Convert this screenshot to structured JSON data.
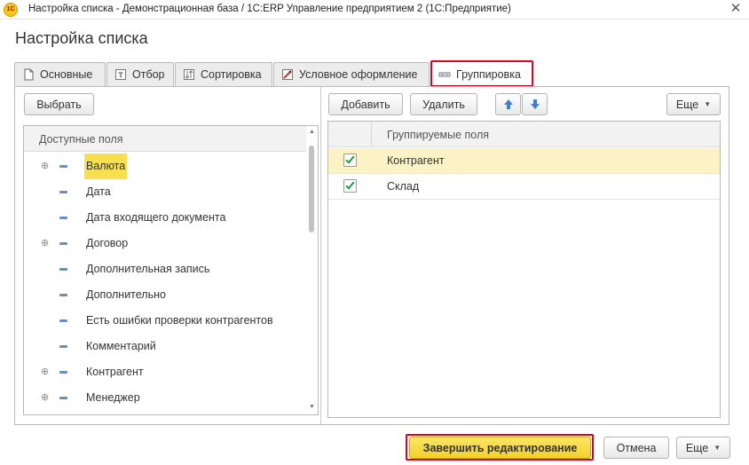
{
  "window": {
    "logo_text": "1С",
    "title": "Настройка списка - Демонстрационная база / 1С:ERP Управление предприятием 2  (1С:Предприятие)",
    "close_glyph": "✕"
  },
  "form": {
    "title": "Настройка списка"
  },
  "tabs": [
    {
      "label": "Основные",
      "icon": "document-icon"
    },
    {
      "label": "Отбор",
      "icon": "filter-icon"
    },
    {
      "label": "Сортировка",
      "icon": "sort-icon"
    },
    {
      "label": "Условное оформление",
      "icon": "conditional-format-icon"
    },
    {
      "label": "Группировка",
      "icon": "grouping-icon",
      "active": true
    }
  ],
  "left": {
    "select_button": "Выбрать",
    "tree_header": "Доступные поля",
    "items": [
      {
        "label": "Валюта",
        "expandable": true,
        "selected": true
      },
      {
        "label": "Дата",
        "expandable": false
      },
      {
        "label": "Дата входящего документа",
        "expandable": false
      },
      {
        "label": "Договор",
        "expandable": true
      },
      {
        "label": "Дополнительная запись",
        "expandable": false
      },
      {
        "label": "Дополнительно",
        "expandable": false
      },
      {
        "label": "Есть ошибки проверки контрагентов",
        "expandable": false
      },
      {
        "label": "Комментарий",
        "expandable": false
      },
      {
        "label": "Контрагент",
        "expandable": true
      },
      {
        "label": "Менеджер",
        "expandable": true
      }
    ],
    "expand_glyph": "⊕"
  },
  "right": {
    "add_button": "Добавить",
    "delete_button": "Удалить",
    "more_button": "Еще",
    "grid_header": "Группируемые поля",
    "rows": [
      {
        "label": "Контрагент",
        "checked": true,
        "selected": true
      },
      {
        "label": "Склад",
        "checked": true,
        "selected": false
      }
    ]
  },
  "footer": {
    "finish_button": "Завершить редактирование",
    "cancel_button": "Отмена",
    "more_button": "Еще"
  },
  "colors": {
    "highlight_border": "#e0001b",
    "selection_yellow": "#f8e04d",
    "primary_button": "#f3d12a",
    "check_green": "#1f9a3a",
    "arrow_blue": "#3b82d6"
  }
}
